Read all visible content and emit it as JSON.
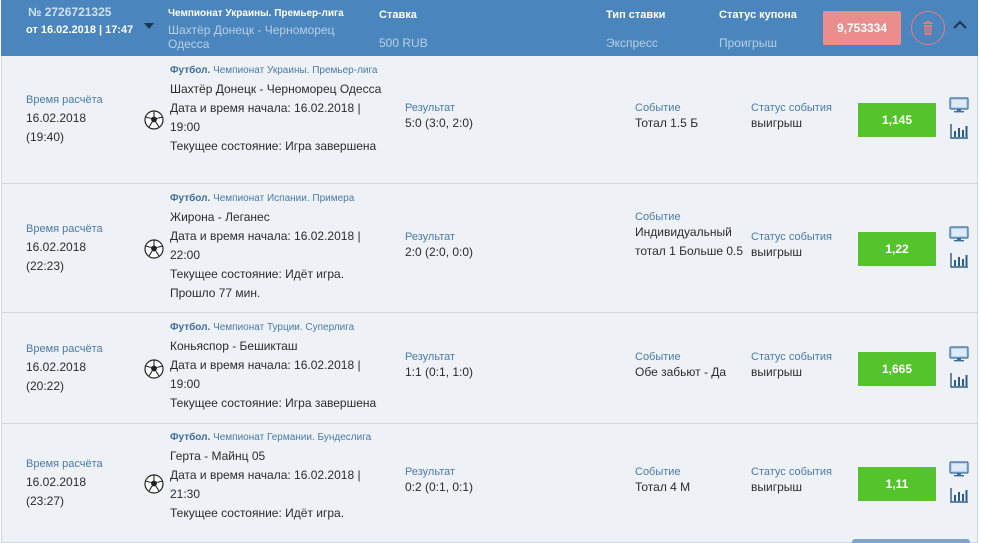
{
  "header": {
    "coupon_number": "№ 2726721325",
    "coupon_date": "от 16.02.2018 | 17:47",
    "league": "Чемпионат Украины. Премьер-лига",
    "match": "Шахтёр Донецк - Черноморец Одесса",
    "stake_label": "Ставка",
    "stake_value": "500 RUB",
    "bet_type_label": "Тип ставки",
    "bet_type_value": "Экспресс",
    "coupon_status_label": "Статус купона",
    "coupon_status_value": "Проигрыш",
    "total_coef": "9,753334"
  },
  "labels": {
    "calc_time": "Время расчёта",
    "result": "Результат",
    "event": "Событие",
    "event_status": "Статус события"
  },
  "rows": [
    {
      "calc_date": "16.02.2018",
      "calc_time": "(19:40)",
      "sport": "Футбол.",
      "league": "Чемпионат Украины. Премьер-лига",
      "teams": "Шахтёр Донецк - Черноморец Одесса",
      "start": "Дата и время начала: 16.02.2018 | 19:00",
      "state": "Текущее состояние: Игра завершена",
      "result": "5:0 (3:0, 2:0)",
      "event": "Тотал 1.5 Б",
      "status": "выигрыш",
      "coef": "1,145"
    },
    {
      "calc_date": "16.02.2018",
      "calc_time": "(22:23)",
      "sport": "Футбол.",
      "league": "Чемпионат Испании. Примера",
      "teams": "Жирона - Леганес",
      "start": "Дата и время начала: 16.02.2018 | 22:00",
      "state": "Текущее состояние: Идёт игра. Прошло 77 мин.",
      "result": "2:0 (2:0, 0:0)",
      "event": "Индивидуальный тотал 1 Больше 0.5",
      "status": "выигрыш",
      "coef": "1,22"
    },
    {
      "calc_date": "16.02.2018",
      "calc_time": "(20:22)",
      "sport": "Футбол.",
      "league": "Чемпионат Турции. Суперлига",
      "teams": "Коньяспор - Бешикташ",
      "start": "Дата и время начала: 16.02.2018 | 19:00",
      "state": "Текущее состояние: Игра завершена",
      "result": "1:1 (0:1, 1:0)",
      "event": "Обе забьют - Да",
      "status": "выигрыш",
      "coef": "1,665"
    },
    {
      "calc_date": "16.02.2018",
      "calc_time": "(23:27)",
      "sport": "Футбол.",
      "league": "Чемпионат Германии. Бундеслига",
      "teams": "Герта - Майнц 05",
      "start": "Дата и время начала: 16.02.2018 | 21:30",
      "state": "Текущее состояние: Идёт игра.",
      "result": "0:2 (0:1, 0:1)",
      "event": "Тотал 4 М",
      "status": "выигрыш",
      "coef": "1,11"
    }
  ],
  "icons": {
    "ball": "soccer-ball-icon",
    "monitor": "monitor-icon",
    "stats": "stats-icon",
    "trash": "trash-icon",
    "collapse": "chevron-up-icon",
    "expand": "chevron-down-icon"
  },
  "colors": {
    "header_bg": "#4a86bd",
    "row_bg": "#eef2f6",
    "coef_green": "#55c32b",
    "total_red": "#ea8d8d",
    "link_blue": "#4a7aa8"
  }
}
